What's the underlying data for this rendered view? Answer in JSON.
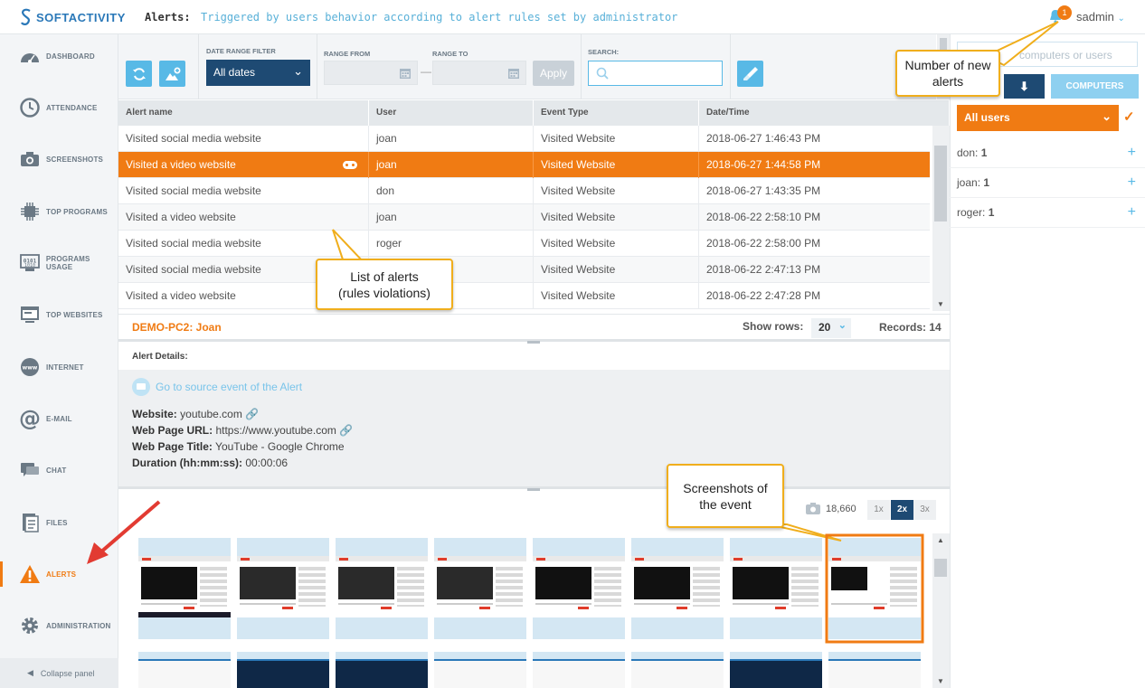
{
  "header": {
    "logo_text": "SOFTACTIVITY",
    "title": "Alerts:",
    "description": "Triggered by users behavior according to alert rules set by administrator",
    "notification_count": "1",
    "user": "sadmin"
  },
  "sidebar": {
    "items": [
      {
        "label": "DASHBOARD",
        "icon": "dashboard-icon"
      },
      {
        "label": "ATTENDANCE",
        "icon": "clock-icon"
      },
      {
        "label": "SCREENSHOTS",
        "icon": "camera-icon"
      },
      {
        "label": "TOP PROGRAMS",
        "icon": "chip-icon"
      },
      {
        "label": "PROGRAMS USAGE",
        "icon": "binary-icon"
      },
      {
        "label": "TOP WEBSITES",
        "icon": "window-icon"
      },
      {
        "label": "INTERNET",
        "icon": "www-icon"
      },
      {
        "label": "E-MAIL",
        "icon": "at-icon"
      },
      {
        "label": "CHAT",
        "icon": "chat-icon"
      },
      {
        "label": "FILES",
        "icon": "file-icon"
      },
      {
        "label": "ALERTS",
        "icon": "warning-icon"
      },
      {
        "label": "ADMINISTRATION",
        "icon": "gear-icon"
      }
    ],
    "active_index": 10,
    "collapse_label": "Collapse panel"
  },
  "toolbar": {
    "date_range_label": "DATE RANGE FILTER",
    "date_range_value": "All dates",
    "range_from_label": "RANGE FROM",
    "range_to_label": "RANGE TO",
    "apply_label": "Apply",
    "search_label": "SEARCH:",
    "search_placeholder": ""
  },
  "table": {
    "columns": [
      "Alert name",
      "User",
      "Event Type",
      "Date/Time"
    ],
    "rows": [
      [
        "Visited social media website",
        "joan",
        "Visited Website",
        "2018-06-27 1:46:43 PM"
      ],
      [
        "Visited a video website",
        "joan",
        "Visited Website",
        "2018-06-27 1:44:58 PM"
      ],
      [
        "Visited social media website",
        "don",
        "Visited Website",
        "2018-06-27 1:43:35 PM"
      ],
      [
        "Visited a video website",
        "joan",
        "Visited Website",
        "2018-06-22 2:58:10 PM"
      ],
      [
        "Visited social media website",
        "roger",
        "Visited Website",
        "2018-06-22 2:58:00 PM"
      ],
      [
        "Visited social media website",
        "",
        "Visited Website",
        "2018-06-22 2:47:13 PM"
      ],
      [
        "Visited a video website",
        "",
        "Visited Website",
        "2018-06-22 2:47:28 PM"
      ]
    ],
    "selected_index": 1,
    "machine": "DEMO-PC2: Joan",
    "show_rows_label": "Show rows:",
    "show_rows_value": "20",
    "records_label": "Records: 14"
  },
  "details": {
    "heading": "Alert Details:",
    "source_link": "Go to source event of the Alert",
    "fields": [
      {
        "label": "Website:",
        "value": "youtube.com"
      },
      {
        "label": "Web Page URL:",
        "value": "https://www.youtube.com"
      },
      {
        "label": "Web Page Title:",
        "value": "YouTube - Google Chrome"
      },
      {
        "label": "Duration (hh:mm:ss):",
        "value": "00:00:06"
      }
    ]
  },
  "screenshots": {
    "count": "18,660",
    "zoom_options": [
      "1x",
      "2x",
      "3x"
    ],
    "zoom_selected": 1
  },
  "right_panel": {
    "search_placeholder": "computers or users",
    "computers_label": "COMPUTERS",
    "all_users_label": "All users",
    "users": [
      {
        "name": "don:",
        "count": "1"
      },
      {
        "name": "joan:",
        "count": "1"
      },
      {
        "name": "roger:",
        "count": "1"
      }
    ]
  },
  "callouts": {
    "new_alerts": "Number of new alerts",
    "list_of_alerts": "List of alerts (rules violations)",
    "screenshots_of_event": "Screenshots of the event"
  },
  "colors": {
    "accent": "#f07b13",
    "primary": "#58b9e6",
    "dark": "#1e4a73",
    "callout_border": "#f0ae1c"
  }
}
